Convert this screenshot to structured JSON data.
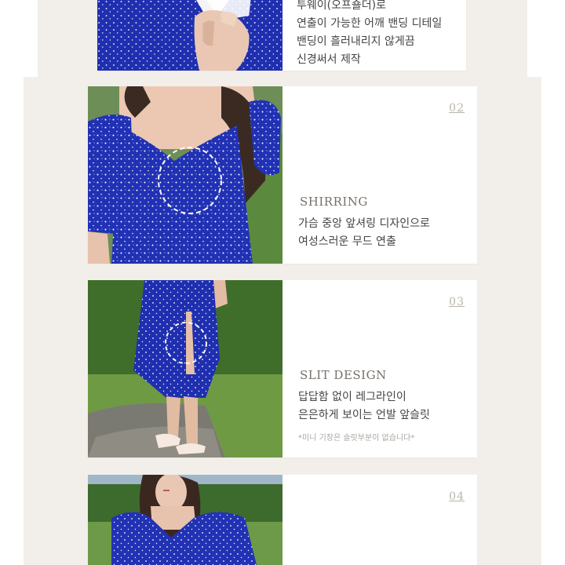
{
  "card1": {
    "lines": [
      "투웨이(오프숄더)로",
      "연출이 가능한 어깨 밴딩 디테일",
      "밴딩이 흘러내리지 않게끔",
      "신경써서 제작"
    ]
  },
  "card2": {
    "number": "02",
    "title": "SHIRRING",
    "lines": [
      "가슴 중앙 앞셔링 디자인으로",
      "여성스러운 무드 연출"
    ]
  },
  "card3": {
    "number": "03",
    "title": "SLIT DESIGN",
    "lines": [
      "답답함 없이 레그라인이",
      "은은하게 보이는 언발 앞슬릿"
    ],
    "note": "*미니 기장은 슬릿부분이 없습니다*"
  },
  "card4": {
    "number": "04"
  },
  "colors": {
    "dress_blue": "#1f2fb0",
    "background": "#f2efea",
    "grass": "#4e7d34"
  }
}
